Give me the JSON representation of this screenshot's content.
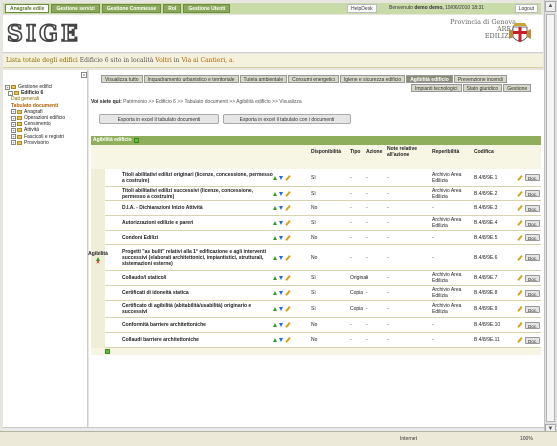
{
  "topnav": {
    "tabs": [
      "Anagrafe edile",
      "Gestione servizi",
      "Gestione Commesse",
      "Rol",
      "Gestione Utenti"
    ],
    "helpdesk": "HelpDesk",
    "welcome_prefix": "Benvenuto",
    "user": "demo demo,",
    "datetime": "19/06/2010 18:31",
    "logout": "Logout"
  },
  "header": {
    "logo": "SIGE",
    "province": "Provincia di Genova",
    "area": "AREA",
    "edilizia": "EDILIZIA"
  },
  "subheader": {
    "part1": "Lista totale degli edifici",
    "part2": "Edificio 6 sito in località",
    "part3": "Voltri",
    "part4": "in",
    "part5": "Via ai Cantieri, a."
  },
  "sidebar": {
    "items": [
      {
        "pm": "+",
        "label": "Gestione edifici"
      },
      {
        "pm": "-",
        "label": "Edificio 6"
      },
      {
        "pm": "",
        "label": "Dati generali"
      },
      {
        "pm": "",
        "label": "Tabulato documenti"
      },
      {
        "pm": "+",
        "label": "Anagrafi"
      },
      {
        "pm": "+",
        "label": "Operazioni edificio"
      },
      {
        "pm": "+",
        "label": "Censimento"
      },
      {
        "pm": "+",
        "label": "Attività"
      },
      {
        "pm": "+",
        "label": "Fascicoli e registri"
      },
      {
        "pm": "+",
        "label": "Provvisorio"
      }
    ]
  },
  "tabs_row1": [
    "Visualizza tutto",
    "Inquadramento urbanistico e territoriale",
    "Tutela ambientale",
    "Consumi energetici",
    "Igiene e sicurezza edificio",
    "Agibilità edificio",
    "Prevenzione incendi"
  ],
  "tabs_row2": [
    "Impianti tecnologici",
    "Stato giuridico",
    "Gestione"
  ],
  "breadcrumb": {
    "label": "Voi siete qui:",
    "path": "Patrimonio >> Edificio 6 >> Tabulato documenti >> Agibilità edificio >> Visualizza"
  },
  "buttons": {
    "export1": "Esporta in excel il tabulato documenti",
    "export2": "Esporta in excel il tabulato con i documenti"
  },
  "table": {
    "title": "Agibilità edificio",
    "group": "Agibilità",
    "columns": [
      "Disponibilità",
      "Tipo",
      "Azione",
      "Note relative all'azione",
      "Reperibilità",
      "Codifica"
    ],
    "doc_label": "Doc.",
    "rows": [
      {
        "title": "Titoli abilitativi edilizi originari (licenze, concessione, permesso a costruire)",
        "disp": "Sì",
        "tipo": "-",
        "azione": "-",
        "note": "-",
        "rep": "Archivio Area Edilizia",
        "cod": "B.4/8/9E.1"
      },
      {
        "title": "Titoli abilitativi edilizi successivi (licenze, concessione, permesso a costruire)",
        "disp": "Sì",
        "tipo": "-",
        "azione": "-",
        "note": "-",
        "rep": "Archivio Area Edilizia",
        "cod": "B.4/8/9E.2"
      },
      {
        "title": "D.I.A. - Dichiarazioni Inizio Attività",
        "disp": "No",
        "tipo": "-",
        "azione": "-",
        "note": "-",
        "rep": "-",
        "cod": "B.4/8/9E.3"
      },
      {
        "title": "Autorizzazioni edilizie e pareri",
        "disp": "Sì",
        "tipo": "-",
        "azione": "-",
        "note": "-",
        "rep": "Archivio Area Edilizia",
        "cod": "B.4/8/9E.4"
      },
      {
        "title": "Condoni Edilizi",
        "disp": "No",
        "tipo": "-",
        "azione": "-",
        "note": "-",
        "rep": "-",
        "cod": "B.4/8/9E.5"
      },
      {
        "title": "Progetti \"as built\" relativi alla 1° edificazione e agli interventi successivi (elaborati architettonici, impiantistici, strutturali, sistemazioni esterne)",
        "disp": "No",
        "tipo": "-",
        "azione": "-",
        "note": "-",
        "rep": "-",
        "cod": "B.4/8/9E.6"
      },
      {
        "title": "Collaudo/i statico/i",
        "disp": "Sì",
        "tipo": "Originali",
        "azione": "-",
        "note": "-",
        "rep": "Archivio Area Edilizia",
        "cod": "B.4/8/9E.7"
      },
      {
        "title": "Certificati di idoneità statica",
        "disp": "Sì",
        "tipo": "Copia",
        "azione": "-",
        "note": "-",
        "rep": "Archivio Area Edilizia",
        "cod": "B.4/8/9E.8"
      },
      {
        "title": "Certificato di agibilità (abitabilità/usabilità) originario e successivi",
        "disp": "Sì",
        "tipo": "Copia",
        "azione": "-",
        "note": "-",
        "rep": "Archivio Area Edilizia",
        "cod": "B.4/8/9E.9"
      },
      {
        "title": "Conformità barriere architettoniche",
        "disp": "No",
        "tipo": "-",
        "azione": "-",
        "note": "-",
        "rep": "-",
        "cod": "B.4/8/9E.10"
      },
      {
        "title": "Collaudi barriere architettoniche",
        "disp": "No",
        "tipo": "-",
        "azione": "-",
        "note": "-",
        "rep": "-",
        "cod": "B.4/8/9E.11"
      }
    ]
  },
  "statusbar": {
    "left": "",
    "zone": "Internet",
    "zoom": "100%"
  }
}
